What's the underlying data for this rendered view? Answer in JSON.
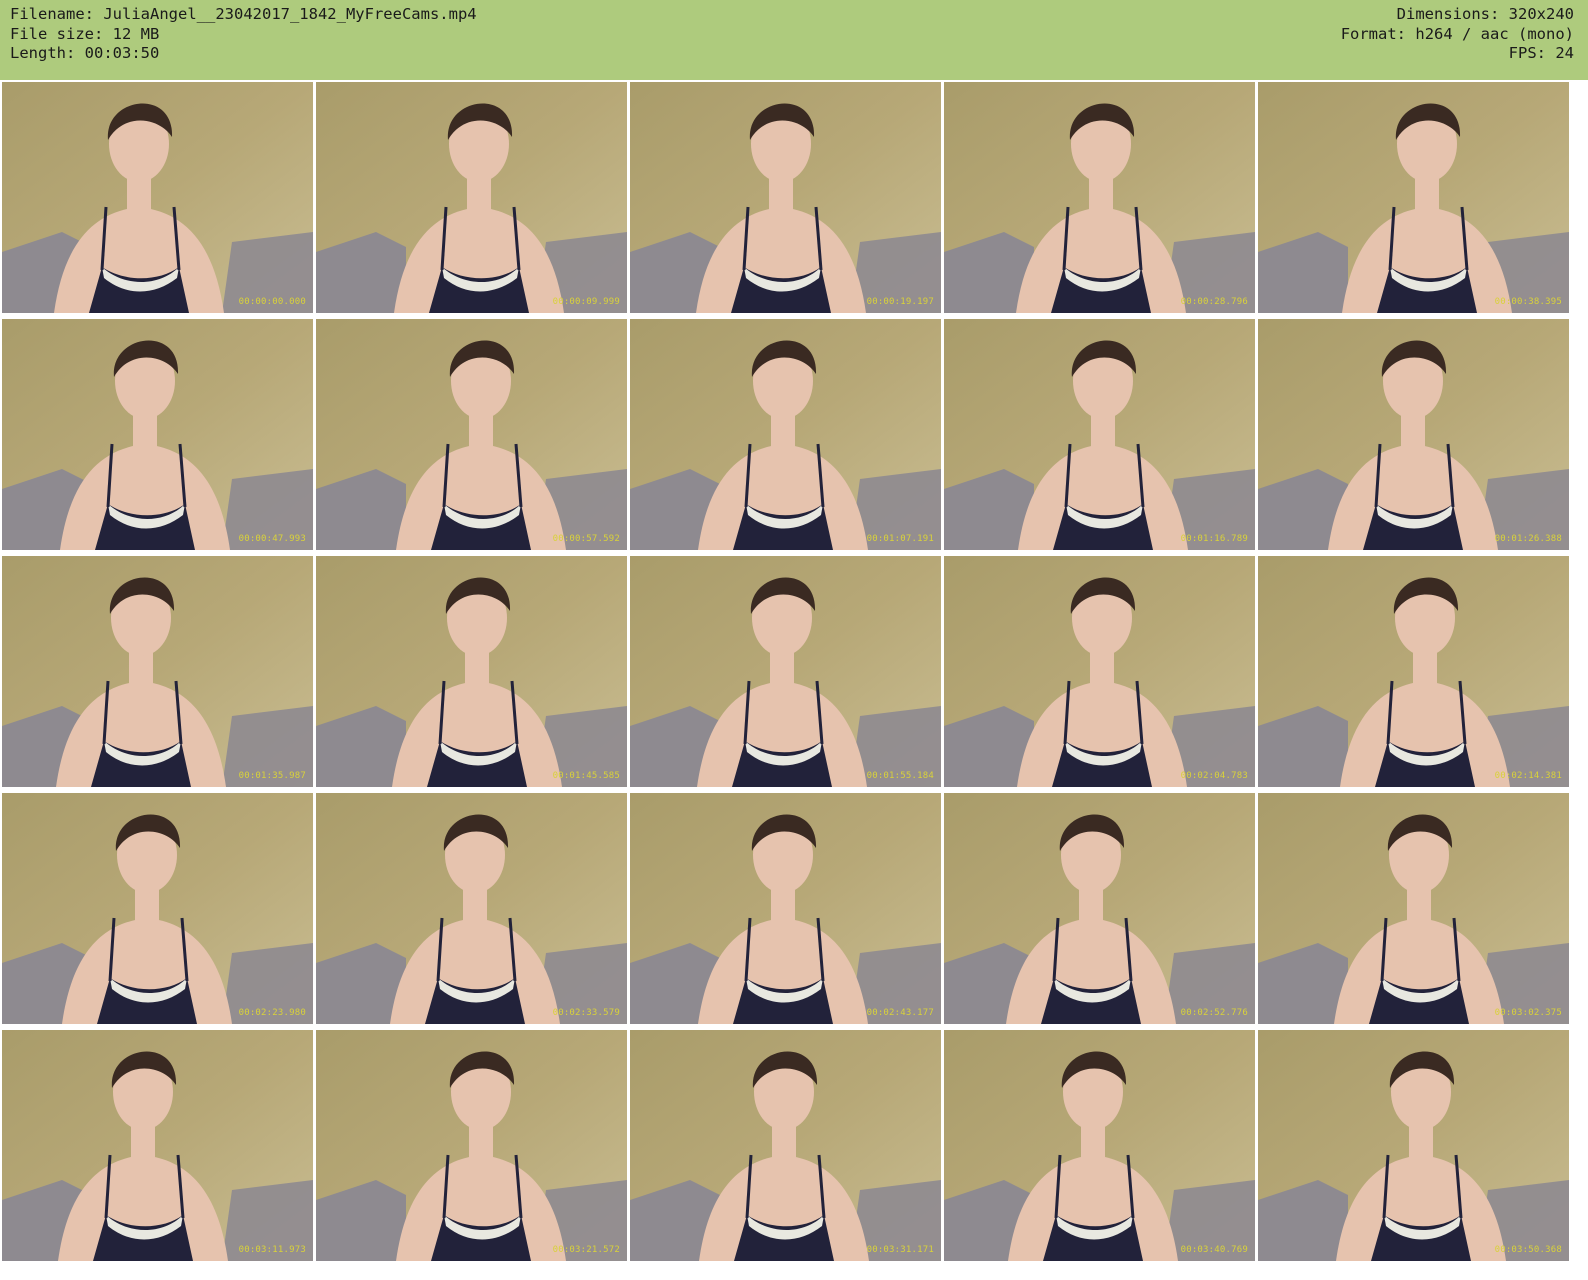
{
  "header": {
    "filename_label": "Filename:",
    "filename": "JuliaAngel__23042017_1842_MyFreeCams.mp4",
    "filesize_label": "File size:",
    "filesize": "12 MB",
    "length_label": "Length:",
    "length": "00:03:50",
    "dimensions_label": "Dimensions:",
    "dimensions": "320x240",
    "format_label": "Format:",
    "format": "h264 / aac (mono)",
    "fps_label": "FPS:",
    "fps": "24"
  },
  "colors": {
    "header_bg": "#aecb7d",
    "wall": "#b7a877",
    "skin": "#e6c3ae",
    "hair": "#3a2a22",
    "garment": "#22223a",
    "lace": "#e8e8e0",
    "sofa": "#8e8a90",
    "timestamp": "#d9d23a"
  },
  "thumbnails": [
    {
      "timestamp": "00:00:00.000"
    },
    {
      "timestamp": "00:00:09.999"
    },
    {
      "timestamp": "00:00:19.197"
    },
    {
      "timestamp": "00:00:28.796"
    },
    {
      "timestamp": "00:00:38.395"
    },
    {
      "timestamp": "00:00:47.993"
    },
    {
      "timestamp": "00:00:57.592"
    },
    {
      "timestamp": "00:01:07.191"
    },
    {
      "timestamp": "00:01:16.789"
    },
    {
      "timestamp": "00:01:26.388"
    },
    {
      "timestamp": "00:01:35.987"
    },
    {
      "timestamp": "00:01:45.585"
    },
    {
      "timestamp": "00:01:55.184"
    },
    {
      "timestamp": "00:02:04.783"
    },
    {
      "timestamp": "00:02:14.381"
    },
    {
      "timestamp": "00:02:23.980"
    },
    {
      "timestamp": "00:02:33.579"
    },
    {
      "timestamp": "00:02:43.177"
    },
    {
      "timestamp": "00:02:52.776"
    },
    {
      "timestamp": "00:03:02.375"
    },
    {
      "timestamp": "00:03:11.973"
    },
    {
      "timestamp": "00:03:21.572"
    },
    {
      "timestamp": "00:03:31.171"
    },
    {
      "timestamp": "00:03:40.769"
    },
    {
      "timestamp": "00:03:50.368"
    }
  ]
}
